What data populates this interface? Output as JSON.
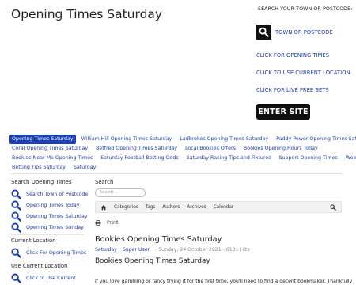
{
  "header": {
    "site_title": "Opening Times Saturday"
  },
  "side": {
    "heading": "SEARCH YOUR TOWN OR POSTCODE:",
    "search_label": "TOWN OR POSTCODE",
    "links": [
      "CLICK FOR OPENING TIMES",
      "CLICK TO USE CURRENT LOCATION",
      "CLICK FOR LIVE FREE BETS"
    ],
    "enter_button": "ENTER SITE"
  },
  "nav": {
    "rows": [
      [
        "Opening Times Saturday",
        "William Hill Opening Times Saturday",
        "Ladbrokes Opening Times Saturday",
        "Paddy Power Opening Times Saturday"
      ],
      [
        "Coral Opening Times Saturday",
        "Betfred Opening Times Saturday",
        "Local Bookies Offers",
        "Bookies Opening Hours Today"
      ],
      [
        "Bookies Near Me Opening Times",
        "Saturday Football Betting Odds",
        "Saturday Racing Tips and Fixtures",
        "Support Opening Times",
        "Weekdays"
      ],
      [
        "Betting Tips Saturday",
        "Saturday"
      ]
    ]
  },
  "left": {
    "section1_title": "Search Opening Times",
    "section1_items": [
      "Search Town or Postcode",
      "Opening Times Today",
      "Opening Times Saturday",
      "Opening Times Sunday"
    ],
    "section2_title": "Current Location",
    "section2_items": [
      "Click For Opening Times"
    ],
    "section3_title": "Use Current Location",
    "section3_items": [
      "Click to Use Current"
    ]
  },
  "main": {
    "search_label": "Search",
    "search_placeholder": "Search ...",
    "toolbar": [
      "Categories",
      "Tags",
      "Authors",
      "Archives",
      "Calendar"
    ],
    "print_label": "Print",
    "article_title": "Bookies Opening Times Saturday",
    "meta_category": "Saturday",
    "meta_author": "Super User",
    "meta_date": "- Sunday, 24 October 2021",
    "meta_hits": "- 6131 Hits",
    "article_subtitle": "Bookies Opening Times Saturday",
    "article_body": "If you love gambling or fancy trying it for the first time, you'll need to find a decent bookmaker. Thankfully"
  },
  "colors": {
    "link": "#1a3fae",
    "active_tab_bg": "#1a3fae"
  }
}
